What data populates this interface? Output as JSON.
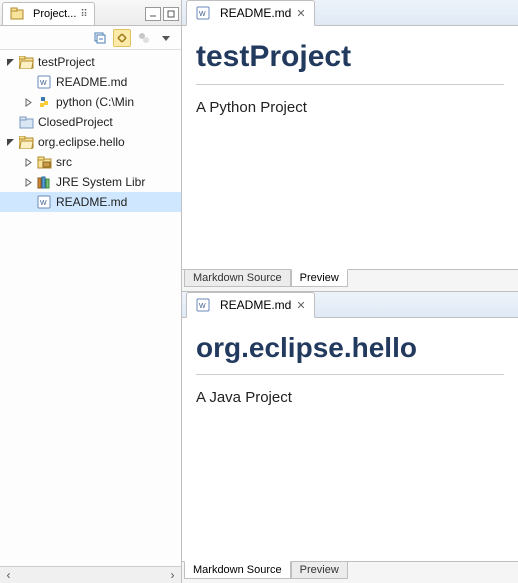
{
  "projectView": {
    "title": "Project...",
    "toolbarIcons": [
      "collapse",
      "link",
      "filter",
      "menu"
    ]
  },
  "tree": {
    "nodes": [
      {
        "label": "testProject",
        "indent": 0,
        "expanded": true,
        "icon": "project-open"
      },
      {
        "label": "README.md",
        "indent": 1,
        "expanded": null,
        "icon": "md-file"
      },
      {
        "label": "python  (C:\\Min",
        "indent": 1,
        "expanded": false,
        "icon": "python-pkg"
      },
      {
        "label": "ClosedProject",
        "indent": 0,
        "expanded": null,
        "icon": "project-closed"
      },
      {
        "label": "org.eclipse.hello",
        "indent": 0,
        "expanded": true,
        "icon": "project-open"
      },
      {
        "label": "src",
        "indent": 1,
        "expanded": false,
        "icon": "src-folder"
      },
      {
        "label": "JRE System Libr",
        "indent": 1,
        "expanded": false,
        "icon": "jre-lib"
      },
      {
        "label": "README.md",
        "indent": 1,
        "expanded": null,
        "icon": "md-file",
        "selected": true
      }
    ]
  },
  "editors": [
    {
      "tabIcon": "md-file",
      "tabTitle": "README.md",
      "heading": "testProject",
      "body": "A Python Project",
      "bottomTabs": {
        "source": "Markdown Source",
        "preview": "Preview",
        "active": "preview"
      }
    },
    {
      "tabIcon": "md-file",
      "tabTitle": "README.md",
      "heading": "org.eclipse.hello",
      "body": "A Java Project",
      "bottomTabs": {
        "source": "Markdown Source",
        "preview": "Preview",
        "active": "source"
      }
    }
  ]
}
